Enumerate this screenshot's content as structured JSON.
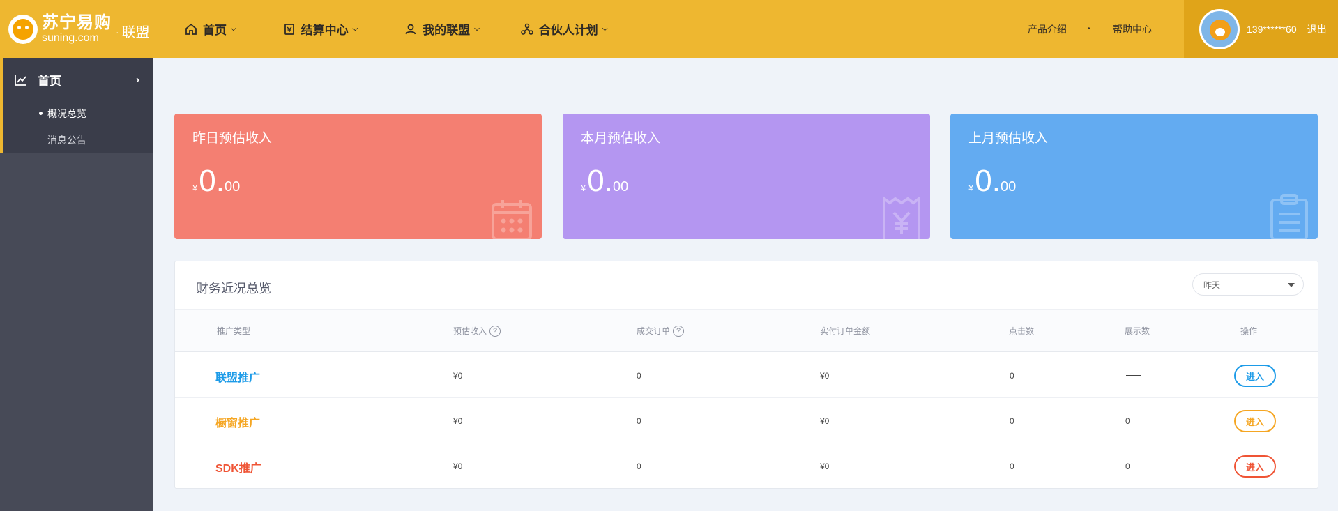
{
  "brand": {
    "logo_cn": "苏宁易购",
    "logo_en": "suning.com",
    "separator": "·",
    "product": "联盟"
  },
  "nav": [
    {
      "label": "首页",
      "icon": "home-icon"
    },
    {
      "label": "结算中心",
      "icon": "settlement-icon"
    },
    {
      "label": "我的联盟",
      "icon": "user-icon"
    },
    {
      "label": "合伙人计划",
      "icon": "partner-icon"
    }
  ],
  "top_links": {
    "intro": "产品介绍",
    "bullet": "•",
    "help": "帮助中心"
  },
  "user": {
    "name": "139******60",
    "logout": "退出"
  },
  "sidebar": {
    "section": "首页",
    "items": [
      {
        "label": "概况总览",
        "active": true
      },
      {
        "label": "消息公告",
        "active": false
      }
    ]
  },
  "cards": [
    {
      "title": "昨日预估收入",
      "currency": "¥",
      "int": "0",
      "dot": ".",
      "dec": "00",
      "color": "#f47f72",
      "icon": "calendar-icon"
    },
    {
      "title": "本月预估收入",
      "currency": "¥",
      "int": "0",
      "dot": ".",
      "dec": "00",
      "color": "#b496f1",
      "icon": "receipt-icon"
    },
    {
      "title": "上月预估收入",
      "currency": "¥",
      "int": "0",
      "dot": ".",
      "dec": "00",
      "color": "#63abf1",
      "icon": "clipboard-icon"
    }
  ],
  "panel": {
    "title": "财务近况总览",
    "period_select": "昨天",
    "help_mark": "?",
    "columns": [
      "推广类型",
      "预估收入",
      "成交订单",
      "实付订单金额",
      "点击数",
      "展示数",
      "操作"
    ],
    "rows": [
      {
        "type": "联盟推广",
        "color": "#1c9be8",
        "income": "¥0",
        "orders": "0",
        "amount": "¥0",
        "clicks": "0",
        "views": "",
        "action": "进入"
      },
      {
        "type": "橱窗推广",
        "color": "#f5a623",
        "income": "¥0",
        "orders": "0",
        "amount": "¥0",
        "clicks": "0",
        "views": "0",
        "action": "进入"
      },
      {
        "type": "SDK推广",
        "color": "#ef5435",
        "income": "¥0",
        "orders": "0",
        "amount": "¥0",
        "clicks": "0",
        "views": "0",
        "action": "进入"
      }
    ]
  }
}
